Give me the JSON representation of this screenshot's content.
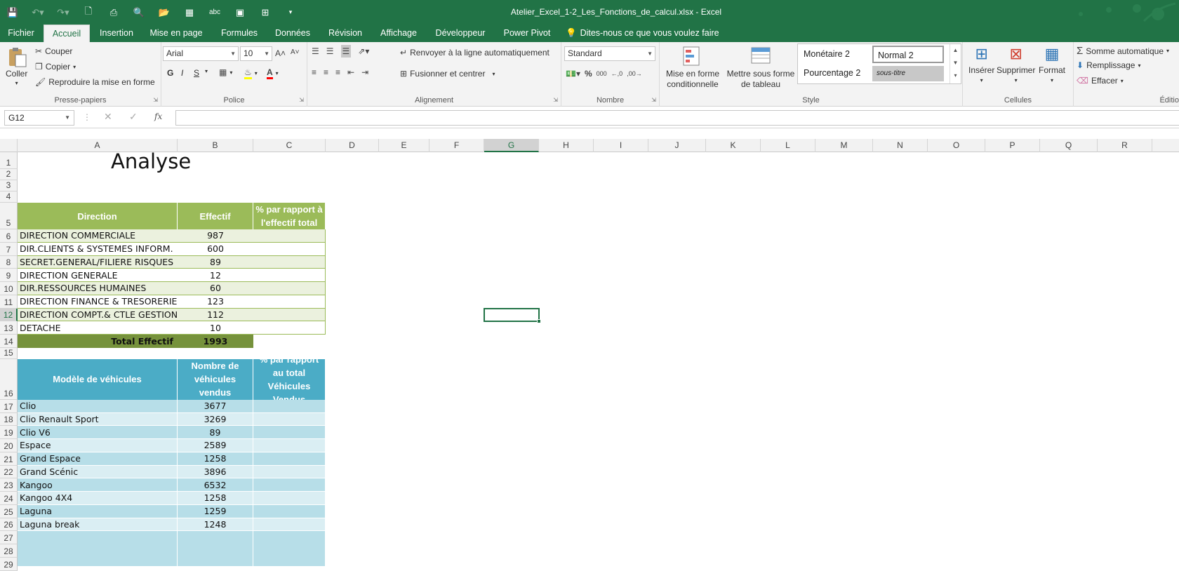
{
  "window": {
    "title": "Atelier_Excel_1-2_Les_Fonctions_de_calcul.xlsx - Excel"
  },
  "tabs": [
    "Fichier",
    "Accueil",
    "Insertion",
    "Mise en page",
    "Formules",
    "Données",
    "Révision",
    "Affichage",
    "Développeur",
    "Power Pivot"
  ],
  "tell_me": "Dites-nous ce que vous voulez faire",
  "ribbon": {
    "clipboard": {
      "paste": "Coller",
      "cut": "Couper",
      "copy": "Copier",
      "format_painter": "Reproduire la mise en forme",
      "label": "Presse-papiers"
    },
    "font": {
      "name": "Arial",
      "size": "10",
      "bold": "G",
      "italic": "I",
      "underline": "S",
      "label": "Police"
    },
    "alignment": {
      "wrap": "Renvoyer à la ligne automatiquement",
      "merge": "Fusionner et centrer",
      "label": "Alignement"
    },
    "number": {
      "format": "Standard",
      "percent": "%",
      "thousands": "000",
      "label": "Nombre"
    },
    "styles": {
      "conditional": "Mise en forme conditionnelle",
      "table": "Mettre sous forme de tableau",
      "monetaire": "Monétaire 2",
      "normal": "Normal 2",
      "pourcentage": "Pourcentage 2",
      "soustitre": "sous-titre",
      "label": "Style"
    },
    "cells": {
      "insert": "Insérer",
      "delete": "Supprimer",
      "format": "Format",
      "label": "Cellules"
    },
    "editing": {
      "autosum": "Somme automatique",
      "fill": "Remplissage",
      "clear": "Effacer",
      "label": "Éditio"
    }
  },
  "formula_bar": {
    "name_box": "G12",
    "fx": "fx",
    "value": ""
  },
  "columns": [
    "A",
    "B",
    "C",
    "D",
    "E",
    "F",
    "G",
    "H",
    "I",
    "J",
    "K",
    "L",
    "M",
    "N",
    "O",
    "P",
    "Q",
    "R"
  ],
  "selected_cell": "G12",
  "sheet": {
    "title": "Analyse",
    "table1": {
      "headers": [
        "Direction",
        "Effectif",
        "% par rapport à l'effectif total"
      ],
      "rows": [
        [
          "DIRECTION COMMERCIALE",
          "987"
        ],
        [
          "DIR.CLIENTS & SYSTEMES INFORM.",
          "600"
        ],
        [
          "SECRET.GENERAL/FILIERE RISQUES",
          "89"
        ],
        [
          "DIRECTION GENERALE",
          "12"
        ],
        [
          "DIR.RESSOURCES HUMAINES",
          "60"
        ],
        [
          "DIRECTION FINANCE & TRESORERIE",
          "123"
        ],
        [
          "DIRECTION COMPT.& CTLE GESTION",
          "112"
        ],
        [
          "DETACHE",
          "10"
        ]
      ],
      "total_label": "Total Effectif",
      "total_value": "1993"
    },
    "table2": {
      "headers": [
        "Modèle de véhicules",
        "Nombre de véhicules vendus",
        "% par rapport au total Véhicules Vendus"
      ],
      "rows": [
        [
          "Clio",
          "3677"
        ],
        [
          "Clio Renault Sport",
          "3269"
        ],
        [
          "Clio V6",
          "89"
        ],
        [
          "Espace",
          "2589"
        ],
        [
          "Grand Espace",
          "1258"
        ],
        [
          "Grand Scénic",
          "3896"
        ],
        [
          "Kangoo",
          "6532"
        ],
        [
          "Kangoo 4X4",
          "1258"
        ],
        [
          "Laguna",
          "1259"
        ],
        [
          "Laguna break",
          "1248"
        ]
      ]
    }
  },
  "colors": {
    "excel_green": "#217346",
    "t1_header": "#9bbb59",
    "t1_band": "#ebf1de",
    "t1_total": "#76923c",
    "t2_header": "#4bacc6",
    "t2_dark": "#b7dee8",
    "t2_light": "#daeef3"
  }
}
